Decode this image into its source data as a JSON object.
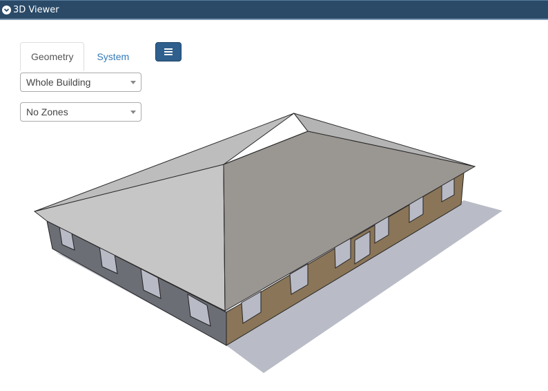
{
  "panel": {
    "title": "3D Viewer",
    "collapse_icon": "chevron-down-icon"
  },
  "tabs": [
    {
      "label": "Geometry",
      "active": true
    },
    {
      "label": "System",
      "active": false
    }
  ],
  "menu_button": {
    "icon": "hamburger-menu-icon",
    "color": "#2f5f8c"
  },
  "selects": {
    "building": {
      "value": "Whole Building"
    },
    "zones": {
      "value": "No Zones"
    }
  },
  "scene": {
    "roof_color_lit": "#c9c9c9",
    "roof_color_shade": "#9a9692",
    "wall_color_front": "#8a7558",
    "wall_color_side": "#6c6e76",
    "window_color": "#b8bac6",
    "shadow_color": "#b9bcc6"
  }
}
